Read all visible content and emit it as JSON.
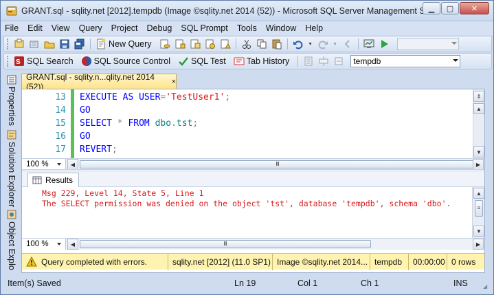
{
  "window": {
    "title": "GRANT.sql - sqlity.net [2012].tempdb (Image ©sqlity.net 2014 (52)) - Microsoft SQL Server Management St..."
  },
  "menu": [
    "File",
    "Edit",
    "View",
    "Query",
    "Project",
    "Debug",
    "SQL Prompt",
    "Tools",
    "Window",
    "Help"
  ],
  "toolbar1": {
    "new_query": "New Query",
    "icons": [
      "new-project-icon",
      "add-item-icon",
      "open-file-icon",
      "save-icon",
      "save-all-icon",
      "new-query-icon",
      "db-engine-query-icon",
      "analysis-query-icon",
      "mdx-query-icon",
      "xmla-query-icon",
      "cut-icon",
      "copy-icon",
      "paste-icon",
      "undo-icon",
      "redo-icon",
      "nav-back-icon",
      "monitor-icon",
      "start-debug-icon"
    ]
  },
  "toolbar2": {
    "sql_search": "SQL Search",
    "sql_source_control": "SQL Source Control",
    "sql_test": "SQL Test",
    "tab_history": "Tab History",
    "database": "tempdb"
  },
  "side_tabs": [
    "Properties",
    "Solution Explorer",
    "Object Explo"
  ],
  "document_tab": {
    "label": "GRANT.sql - sqlity.n...qlity.net 2014 (52))",
    "close": "×"
  },
  "editor": {
    "lines": [
      {
        "num": "13",
        "parts": [
          {
            "t": "EXECUTE AS USER",
            "c": "kw"
          },
          {
            "t": "=",
            "c": "gray"
          },
          {
            "t": "'TestUser1'",
            "c": "str"
          },
          {
            "t": ";",
            "c": "gray"
          }
        ]
      },
      {
        "num": "14",
        "parts": [
          {
            "t": "GO",
            "c": "kw"
          }
        ]
      },
      {
        "num": "15",
        "parts": [
          {
            "t": "SELECT",
            "c": "kw"
          },
          {
            "t": " ",
            "c": "kw"
          },
          {
            "t": "*",
            "c": "gray"
          },
          {
            "t": " FROM ",
            "c": "kw"
          },
          {
            "t": "dbo",
            "c": "obj"
          },
          {
            "t": ".",
            "c": "gray"
          },
          {
            "t": "tst",
            "c": "obj"
          },
          {
            "t": ";",
            "c": "gray"
          }
        ]
      },
      {
        "num": "16",
        "parts": [
          {
            "t": "GO",
            "c": "kw"
          }
        ]
      },
      {
        "num": "17",
        "parts": [
          {
            "t": "REVERT",
            "c": "kw"
          },
          {
            "t": ";",
            "c": "gray"
          }
        ]
      }
    ],
    "zoom": "100 %"
  },
  "results": {
    "tab_label": "Results",
    "messages": [
      "Msg 229, Level 14, State 5, Line 1",
      "The SELECT permission was denied on the object 'tst', database 'tempdb', schema 'dbo'."
    ],
    "zoom": "100 %"
  },
  "exec_status": {
    "message": "Query completed with errors.",
    "server": "sqlity.net [2012] (11.0 SP1)",
    "login": "Image ©sqlity.net 2014...",
    "database": "tempdb",
    "time": "00:00:00",
    "rows": "0 rows"
  },
  "app_status": {
    "left": "Item(s) Saved",
    "ln": "Ln 19",
    "col": "Col 1",
    "ch": "Ch 1",
    "mode": "INS"
  },
  "colors": {
    "keyword": "#0000ff",
    "string": "#e01a1a",
    "object": "#008080",
    "error_text": "#d41c1c",
    "status_yellow": "#fff3b0"
  }
}
